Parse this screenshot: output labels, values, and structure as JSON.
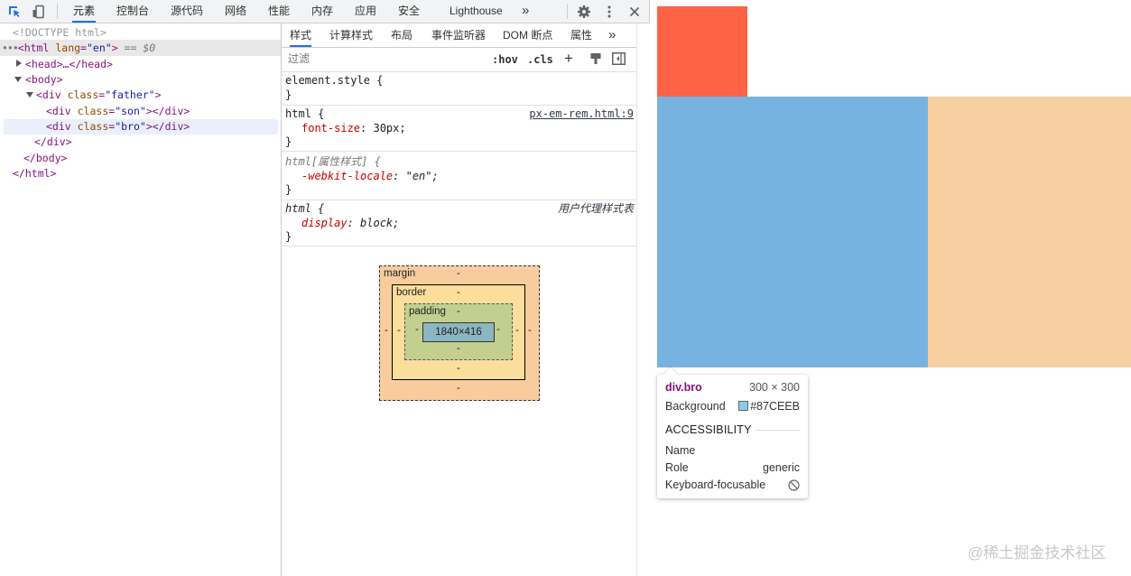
{
  "toolbar": {
    "tabs": [
      "元素",
      "控制台",
      "源代码",
      "网络",
      "性能",
      "内存",
      "应用",
      "安全",
      "Lighthouse"
    ],
    "active_tab": "元素",
    "more_tabs": "»"
  },
  "tree": {
    "doctype": "<!DOCTYPE html>",
    "html_open_tag": "<html",
    "html_lang_attr": "lang",
    "html_lang_val": "\"en\"",
    "html_close_bracket": ">",
    "selected_marker": "== $0",
    "head": "<head>…</head>",
    "body_open": "<body>",
    "father_open": "<div",
    "father_attr": "class",
    "father_val": "\"father\"",
    "father_close": ">",
    "son_open": "<div",
    "son_attr": "class",
    "son_val": "\"son\"",
    "son_close": "></div>",
    "bro_open": "<div",
    "bro_attr": "class",
    "bro_val": "\"bro\"",
    "bro_close": "></div>",
    "div_end": "</div>",
    "body_end": "</body>",
    "html_end": "</html>"
  },
  "styles": {
    "subtabs": [
      "样式",
      "计算样式",
      "布局",
      "事件监听器",
      "DOM 断点",
      "属性"
    ],
    "active_subtab": "样式",
    "more": "»",
    "filter_placeholder": "过滤",
    "hov": ":hov",
    "cls": ".cls",
    "plus": "+",
    "rules": {
      "element_selector": "element.style {",
      "close": "}",
      "html_selector": "html {",
      "html_source": "px-em-rem.html:9",
      "font_size_prop": "font-size",
      "font_size_val": "30px;",
      "attr_selector": "html[属性样式] {",
      "locale_prop": "-webkit-locale",
      "locale_val": "\"en\";",
      "ua_selector": "html {",
      "ua_source": "用户代理样式表",
      "display_prop": "display",
      "display_val": "block;"
    }
  },
  "box_model": {
    "margin_label": "margin",
    "border_label": "border",
    "padding_label": "padding",
    "content_size": "1840×416",
    "dash": "-"
  },
  "tooltip": {
    "element": "div.bro",
    "size": "300 × 300",
    "background_label": "Background",
    "background_value": "#87CEEB",
    "accessibility_heading": "ACCESSIBILITY",
    "name_label": "Name",
    "role_label": "Role",
    "role_value": "generic",
    "keyboard_label": "Keyboard-focusable"
  },
  "colors": {
    "son": "#FF6347",
    "bro_highlight": "#77B3E0",
    "father_highlight": "#F8CFA0",
    "swatch": "#87CEEB"
  },
  "watermark": "@稀土掘金技术社区"
}
